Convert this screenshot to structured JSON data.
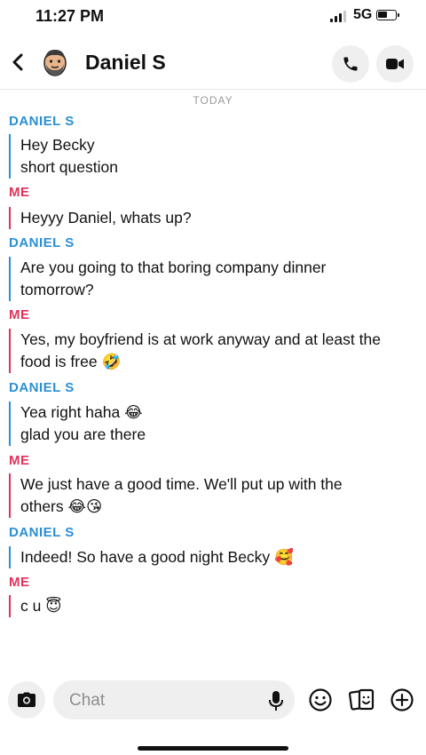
{
  "status_bar": {
    "time": "11:27 PM",
    "network": "5G"
  },
  "header": {
    "contact_name": "Daniel S",
    "back_icon": "chevron-left-icon",
    "call_icon": "phone-icon",
    "video_icon": "video-camera-icon"
  },
  "day_separator": "TODAY",
  "messages": [
    {
      "sender": "DANIEL S",
      "from": "them",
      "lines": [
        "Hey Becky",
        "short question"
      ]
    },
    {
      "sender": "ME",
      "from": "me",
      "lines": [
        "Heyyy Daniel, whats up?"
      ]
    },
    {
      "sender": "DANIEL S",
      "from": "them",
      "lines": [
        "Are you going to that boring company dinner",
        "tomorrow?"
      ]
    },
    {
      "sender": "ME",
      "from": "me",
      "lines": [
        "Yes, my boyfriend is at work anyway and at least the",
        "food is free 🤣"
      ]
    },
    {
      "sender": "DANIEL S",
      "from": "them",
      "lines": [
        "Yea right haha 😂",
        "glad you are there"
      ]
    },
    {
      "sender": "ME",
      "from": "me",
      "lines": [
        "We just have a good time. We'll put up with the",
        "others 😂😘"
      ]
    },
    {
      "sender": "DANIEL S",
      "from": "them",
      "lines": [
        "Indeed! So have a good night Becky 🥰"
      ]
    },
    {
      "sender": "ME",
      "from": "me",
      "lines": [
        "c u 😇"
      ]
    }
  ],
  "input": {
    "placeholder": "Chat"
  },
  "colors": {
    "them": "#2b8fd6",
    "me": "#e2325b",
    "button_bg": "#efefef"
  },
  "toolbar_icons": [
    "camera-icon",
    "microphone-icon",
    "smiley-icon",
    "stickers-icon",
    "plus-circle-icon"
  ]
}
